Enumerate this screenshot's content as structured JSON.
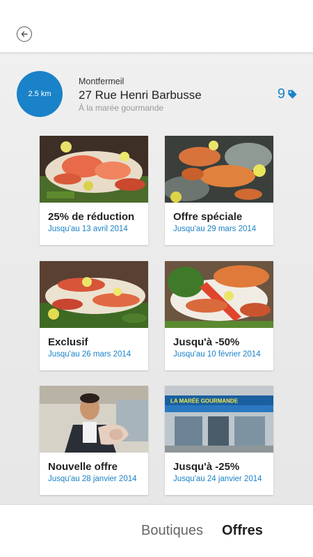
{
  "store": {
    "distance": "2.5 km",
    "city": "Montfermeil",
    "street": "27 Rue Henri Barbusse",
    "name": "À la marée gourmande",
    "offer_count": "9"
  },
  "offers": [
    {
      "title": "25% de réduction",
      "date": "Jusqu'au 13 avril 2014"
    },
    {
      "title": "Offre spéciale",
      "date": "Jusqu'au 29 mars 2014"
    },
    {
      "title": "Exclusif",
      "date": "Jusqu'au 26 mars 2014"
    },
    {
      "title": "Jusqu'à -50%",
      "date": "Jusqu'au 10 février 2014"
    },
    {
      "title": "Nouvelle offre",
      "date": "Jusqu'au 28 janvier 2014"
    },
    {
      "title": "Jusqu'à -25%",
      "date": "Jusqu'au 24 janvier 2014"
    }
  ],
  "storefront_sign": "LA MARÉE GOURMANDE",
  "tabs": {
    "boutiques": "Boutiques",
    "offres": "Offres",
    "active": "offres"
  },
  "colors": {
    "accent": "#1a82c8"
  },
  "icons": {
    "back": "back-arrow-icon",
    "offers": "tag-icon"
  }
}
